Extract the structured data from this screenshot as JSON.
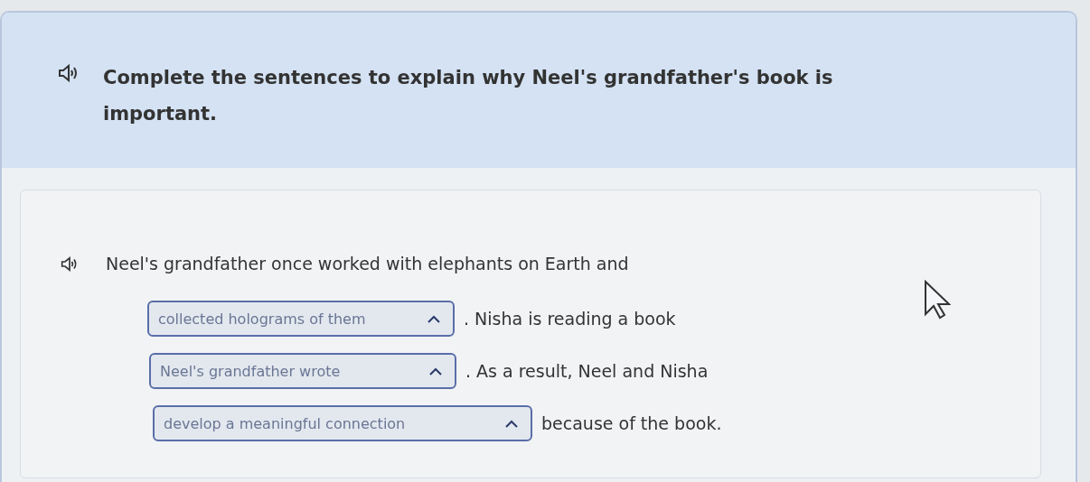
{
  "question": {
    "text": "Complete the sentences to explain why Neel's grandfather's book is important."
  },
  "passage": {
    "lines": [
      {
        "parts": [
          {
            "kind": "text",
            "text": "Neel's grandfather once worked with elephants on Earth and"
          }
        ]
      },
      {
        "parts": [
          {
            "kind": "dropdown",
            "value": "collected holograms of them"
          },
          {
            "kind": "text",
            "text": ". Nisha is reading a book"
          }
        ]
      },
      {
        "parts": [
          {
            "kind": "dropdown",
            "value": "Neel's grandfather wrote"
          },
          {
            "kind": "text",
            "text": ". As a result, Neel and Nisha"
          }
        ]
      },
      {
        "parts": [
          {
            "kind": "dropdown",
            "value": "develop a meaningful connection"
          },
          {
            "kind": "text",
            "text": "because of the book."
          }
        ]
      }
    ]
  }
}
